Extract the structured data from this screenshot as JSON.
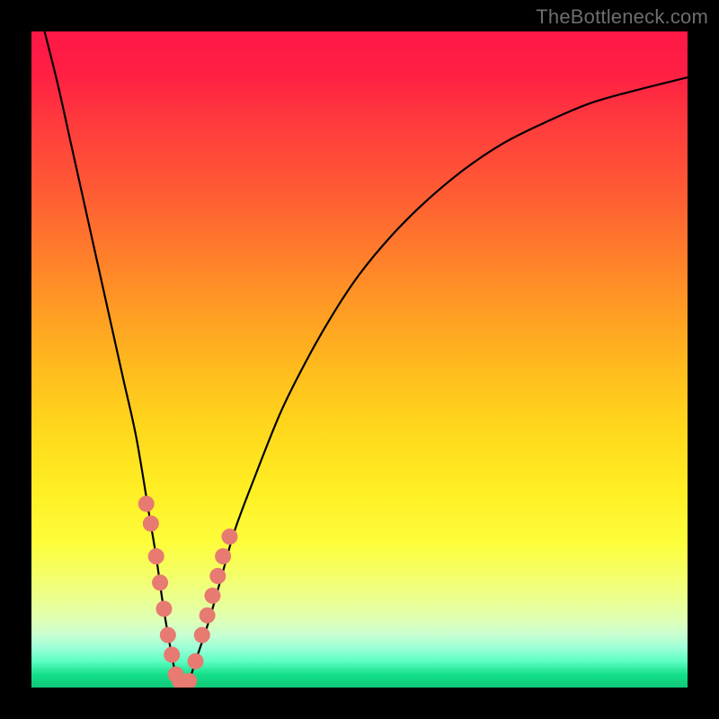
{
  "watermark": {
    "text": "TheBottleneck.com"
  },
  "colors": {
    "frame": "#000000",
    "curve": "#000000",
    "marker": "#e77a71"
  },
  "chart_data": {
    "type": "line",
    "title": "",
    "xlabel": "",
    "ylabel": "",
    "xlim": [
      0,
      100
    ],
    "ylim": [
      0,
      100
    ],
    "grid": false,
    "legend": false,
    "series": [
      {
        "name": "bottleneck-curve",
        "x": [
          2,
          4,
          6,
          8,
          10,
          12,
          14,
          16,
          18,
          19,
          20,
          21,
          22,
          23,
          24,
          25,
          27,
          29,
          31,
          34,
          38,
          42,
          46,
          50,
          55,
          60,
          66,
          72,
          78,
          85,
          92,
          100
        ],
        "y": [
          100,
          92,
          83,
          74,
          65,
          56,
          47,
          38,
          26,
          20,
          13,
          7,
          2,
          0,
          1,
          4,
          10,
          17,
          24,
          32,
          42,
          50,
          57,
          63,
          69,
          74,
          79,
          83,
          86,
          89,
          91,
          93
        ]
      },
      {
        "name": "highlight-markers",
        "x": [
          17.5,
          18.2,
          19.0,
          19.6,
          20.2,
          20.8,
          21.4,
          22.0,
          22.6,
          23.2,
          24.0,
          25.0,
          26.0,
          26.8,
          27.6,
          28.4,
          29.2,
          30.2
        ],
        "y": [
          28,
          25,
          20,
          16,
          12,
          8,
          5,
          2,
          1,
          0,
          1,
          4,
          8,
          11,
          14,
          17,
          20,
          23
        ]
      }
    ]
  }
}
